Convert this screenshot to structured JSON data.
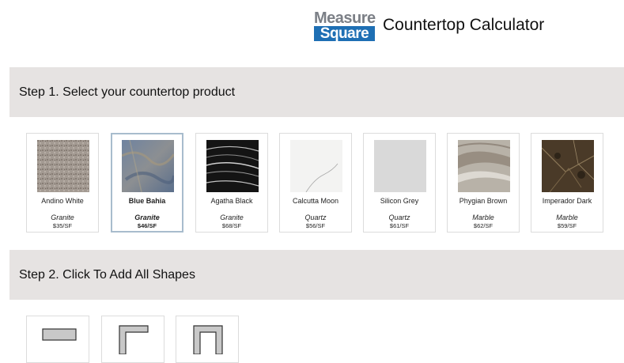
{
  "header": {
    "logo_top": "Measure",
    "logo_bottom": "Square",
    "title": "Countertop Calculator",
    "colors": {
      "logo_grey": "#7b7f86",
      "logo_blue": "#1e6fb4"
    }
  },
  "step1": {
    "title": "Step 1. Select your countertop product"
  },
  "products": [
    {
      "name": "Andino White",
      "type": "Granite",
      "price": "$35/SF",
      "selected": false
    },
    {
      "name": "Blue Bahia",
      "type": "Granite",
      "price": "$46/SF",
      "selected": true
    },
    {
      "name": "Agatha Black",
      "type": "Granite",
      "price": "$68/SF",
      "selected": false
    },
    {
      "name": "Calcutta Moon",
      "type": "Quartz",
      "price": "$56/SF",
      "selected": false
    },
    {
      "name": "Silicon Grey",
      "type": "Quartz",
      "price": "$61/SF",
      "selected": false
    },
    {
      "name": "Phygian Brown",
      "type": "Marble",
      "price": "$62/SF",
      "selected": false
    },
    {
      "name": "Imperador Dark",
      "type": "Marble",
      "price": "$59/SF",
      "selected": false
    }
  ],
  "step2": {
    "title": "Step 2. Click To Add All Shapes"
  },
  "shapes": [
    {
      "icon": "rectangle-shape-icon"
    },
    {
      "icon": "l-shape-icon"
    },
    {
      "icon": "u-shape-icon"
    }
  ],
  "colors": {
    "step_bar_bg": "#e6e3e2",
    "selected_border": "#a8bccd",
    "shape_fill": "#c8c8c8"
  }
}
